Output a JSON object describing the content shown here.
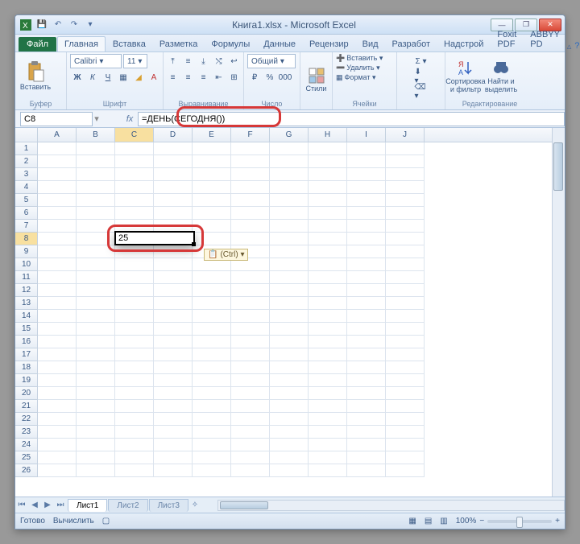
{
  "title": "Книга1.xlsx - Microsoft Excel",
  "tabs": {
    "file": "Файл",
    "list": [
      "Главная",
      "Вставка",
      "Разметка",
      "Формулы",
      "Данные",
      "Рецензир",
      "Вид",
      "Разработ",
      "Надстрой",
      "Foxit PDF",
      "ABBYY PD"
    ],
    "active": 0
  },
  "ribbon": {
    "paste": "Вставить",
    "clipboard_label": "Буфер обмена",
    "font_name": "Calibri",
    "font_size": "11",
    "font_label": "Шрифт",
    "align_label": "Выравнивание",
    "number_format": "Общий",
    "number_label": "Число",
    "styles": "Стили",
    "insert": "Вставить ▾",
    "delete": "Удалить ▾",
    "format": "Формат ▾",
    "cells_label": "Ячейки",
    "sort": "Сортировка и фильтр",
    "find": "Найти и выделить",
    "edit_label": "Редактирование"
  },
  "namebox": "C8",
  "fx": "fx",
  "formula": "=ДЕНЬ(СЕГОДНЯ())",
  "columns": [
    "A",
    "B",
    "C",
    "D",
    "E",
    "F",
    "G",
    "H",
    "I",
    "J"
  ],
  "rows": 26,
  "active_cell": {
    "col": "C",
    "row": 8,
    "value": "25"
  },
  "ctrl_tag": "(Ctrl) ▾",
  "sheets": {
    "active": "Лист1",
    "others": [
      "Лист2",
      "Лист3"
    ]
  },
  "status": {
    "ready": "Готово",
    "calc": "Вычислить",
    "zoom": "100%"
  }
}
